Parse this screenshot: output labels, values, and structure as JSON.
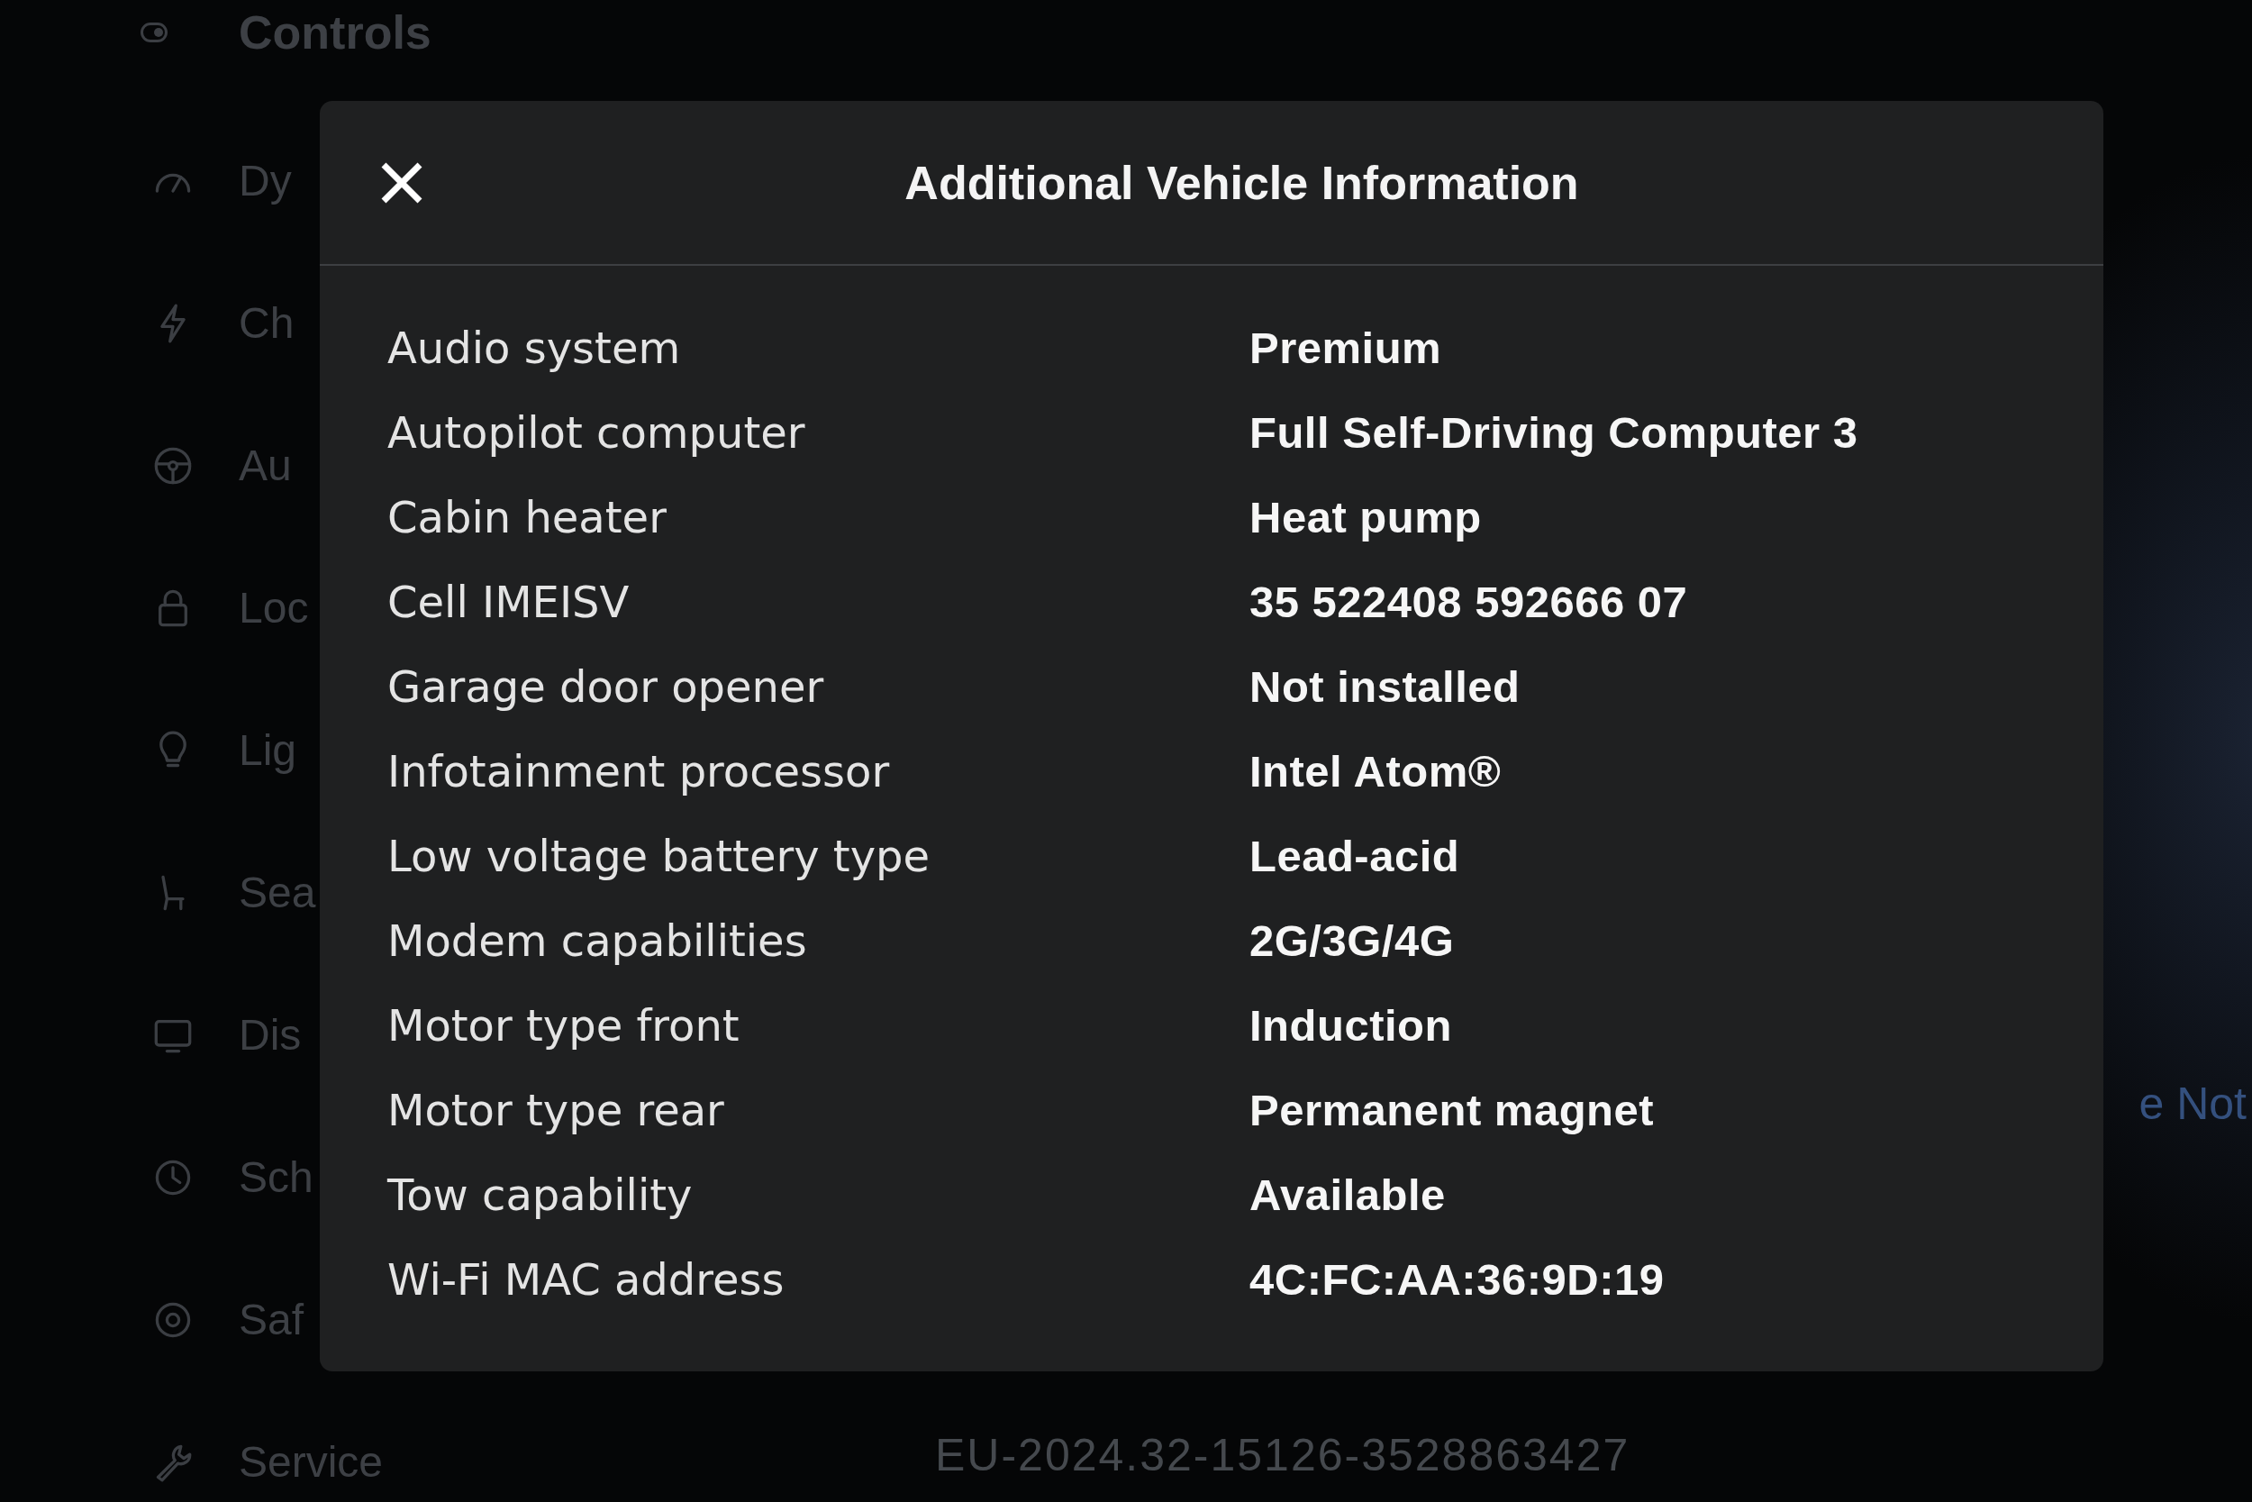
{
  "background": {
    "sidebar": {
      "title": "Controls",
      "items": [
        {
          "label": "Dy"
        },
        {
          "label": "Ch"
        },
        {
          "label": "Au"
        },
        {
          "label": "Loc"
        },
        {
          "label": "Lig"
        },
        {
          "label": "Sea"
        },
        {
          "label": "Dis"
        },
        {
          "label": "Sch"
        },
        {
          "label": "Saf"
        },
        {
          "label": "Service"
        }
      ]
    },
    "link_fragment": "e Not",
    "version": "EU-2024.32-15126-3528863427"
  },
  "dialog": {
    "title": "Additional Vehicle Information",
    "rows": [
      {
        "label": "Audio system",
        "value": "Premium"
      },
      {
        "label": "Autopilot computer",
        "value": "Full Self-Driving Computer 3"
      },
      {
        "label": "Cabin heater",
        "value": "Heat pump"
      },
      {
        "label": "Cell IMEISV",
        "value": "35 522408 592666 07"
      },
      {
        "label": "Garage door opener",
        "value": "Not installed"
      },
      {
        "label": "Infotainment processor",
        "value": "Intel Atom®"
      },
      {
        "label": "Low voltage battery type",
        "value": "Lead-acid"
      },
      {
        "label": "Modem capabilities",
        "value": "2G/3G/4G"
      },
      {
        "label": "Motor type front",
        "value": "Induction"
      },
      {
        "label": "Motor type rear",
        "value": "Permanent magnet"
      },
      {
        "label": "Tow capability",
        "value": "Available"
      },
      {
        "label": "Wi-Fi MAC address",
        "value": "4C:FC:AA:36:9D:19"
      }
    ]
  }
}
